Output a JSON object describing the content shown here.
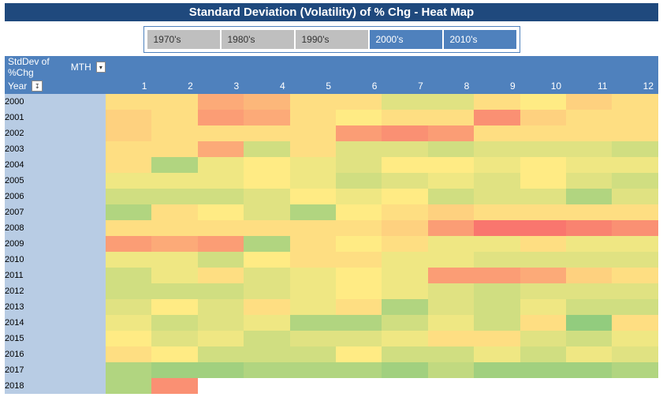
{
  "title": "Standard Deviation (Volatility) of % Chg - Heat Map",
  "slicers": [
    {
      "label": "1970's",
      "selected": false
    },
    {
      "label": "1980's",
      "selected": false
    },
    {
      "label": "1990's",
      "selected": false
    },
    {
      "label": "2000's",
      "selected": true
    },
    {
      "label": "2010's",
      "selected": true
    }
  ],
  "headers": {
    "corner1": "StdDev of %Chg",
    "corner2": "MTH",
    "year_label": "Year",
    "months": [
      "1",
      "2",
      "3",
      "4",
      "5",
      "6",
      "7",
      "8",
      "9",
      "10",
      "11",
      "12"
    ]
  },
  "colors": {
    "accent": "#4f81bd",
    "dark": "#1f497d",
    "row_header": "#b8cce4"
  },
  "chart_data": {
    "type": "heatmap",
    "title": "Standard Deviation (Volatility) of % Chg - Heat Map",
    "xlabel": "MTH",
    "ylabel": "Year",
    "x": [
      1,
      2,
      3,
      4,
      5,
      6,
      7,
      8,
      9,
      10,
      11,
      12
    ],
    "y": [
      2000,
      2001,
      2002,
      2003,
      2004,
      2005,
      2006,
      2007,
      2008,
      2009,
      2010,
      2011,
      2012,
      2013,
      2014,
      2015,
      2016,
      2017,
      2018
    ],
    "note": "Relative volatility scale inferred from color gradient; 0=low (green), 0.5=mid (yellow), 1=high (red). Exact numeric values are not displayed.",
    "values": [
      [
        0.55,
        0.55,
        0.75,
        0.7,
        0.55,
        0.55,
        0.4,
        0.4,
        0.55,
        0.5,
        0.6,
        0.55
      ],
      [
        0.6,
        0.55,
        0.8,
        0.75,
        0.55,
        0.5,
        0.55,
        0.55,
        0.85,
        0.6,
        0.55,
        0.55
      ],
      [
        0.6,
        0.55,
        0.55,
        0.55,
        0.55,
        0.8,
        0.85,
        0.8,
        0.55,
        0.55,
        0.55,
        0.55
      ],
      [
        0.55,
        0.55,
        0.75,
        0.35,
        0.55,
        0.4,
        0.4,
        0.35,
        0.4,
        0.4,
        0.4,
        0.35
      ],
      [
        0.55,
        0.25,
        0.45,
        0.5,
        0.45,
        0.4,
        0.5,
        0.5,
        0.45,
        0.5,
        0.45,
        0.45
      ],
      [
        0.45,
        0.45,
        0.45,
        0.5,
        0.45,
        0.35,
        0.4,
        0.45,
        0.4,
        0.5,
        0.4,
        0.35
      ],
      [
        0.35,
        0.35,
        0.35,
        0.4,
        0.5,
        0.45,
        0.5,
        0.35,
        0.4,
        0.4,
        0.25,
        0.4
      ],
      [
        0.25,
        0.55,
        0.5,
        0.4,
        0.25,
        0.5,
        0.55,
        0.6,
        0.55,
        0.55,
        0.55,
        0.55
      ],
      [
        0.55,
        0.55,
        0.55,
        0.55,
        0.55,
        0.55,
        0.6,
        0.8,
        0.95,
        0.95,
        0.9,
        0.85
      ],
      [
        0.8,
        0.75,
        0.8,
        0.25,
        0.55,
        0.5,
        0.55,
        0.45,
        0.45,
        0.55,
        0.45,
        0.45
      ],
      [
        0.45,
        0.45,
        0.35,
        0.5,
        0.55,
        0.55,
        0.45,
        0.45,
        0.4,
        0.4,
        0.4,
        0.4
      ],
      [
        0.35,
        0.45,
        0.55,
        0.4,
        0.45,
        0.5,
        0.45,
        0.8,
        0.8,
        0.75,
        0.6,
        0.55
      ],
      [
        0.35,
        0.35,
        0.35,
        0.4,
        0.45,
        0.5,
        0.45,
        0.4,
        0.35,
        0.4,
        0.4,
        0.4
      ],
      [
        0.4,
        0.5,
        0.4,
        0.55,
        0.45,
        0.55,
        0.25,
        0.4,
        0.35,
        0.45,
        0.35,
        0.35
      ],
      [
        0.45,
        0.35,
        0.4,
        0.45,
        0.25,
        0.25,
        0.35,
        0.45,
        0.35,
        0.55,
        0.15,
        0.55
      ],
      [
        0.5,
        0.4,
        0.45,
        0.35,
        0.4,
        0.4,
        0.45,
        0.55,
        0.55,
        0.4,
        0.35,
        0.45
      ],
      [
        0.55,
        0.5,
        0.35,
        0.35,
        0.35,
        0.5,
        0.35,
        0.35,
        0.45,
        0.35,
        0.45,
        0.4
      ],
      [
        0.25,
        0.2,
        0.2,
        0.25,
        0.25,
        0.25,
        0.2,
        0.3,
        0.2,
        0.2,
        0.2,
        0.25
      ],
      [
        0.25,
        0.85,
        null,
        null,
        null,
        null,
        null,
        null,
        null,
        null,
        null,
        null
      ]
    ]
  }
}
